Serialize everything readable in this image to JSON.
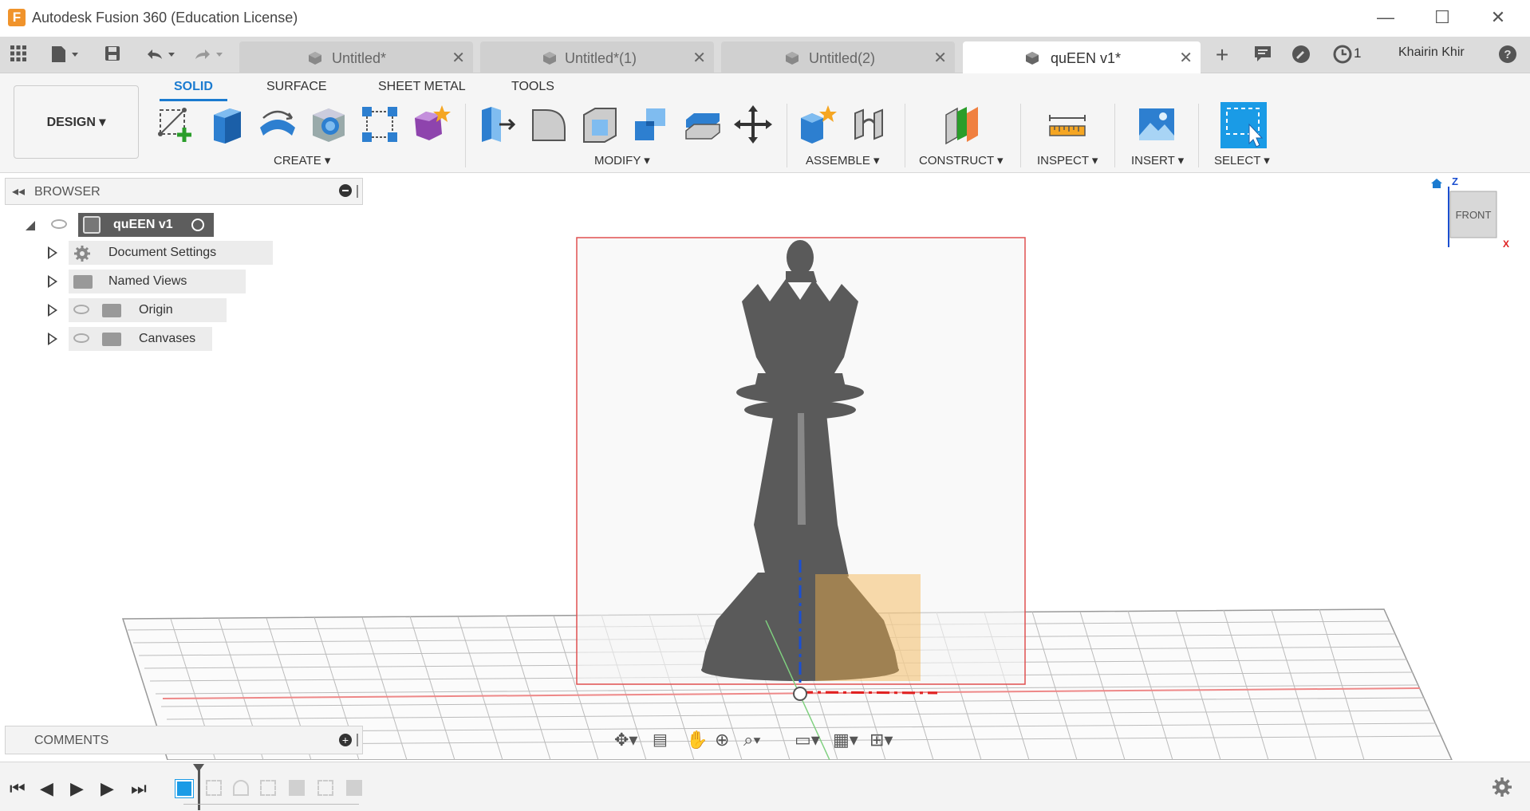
{
  "window": {
    "title": "Autodesk Fusion 360 (Education License)",
    "logo_letter": "F"
  },
  "tabs": [
    {
      "label": "Untitled*"
    },
    {
      "label": "Untitled*(1)"
    },
    {
      "label": "Untitled(2)"
    },
    {
      "label": "quEEN v1*"
    }
  ],
  "header_right": {
    "jobs_count": "1",
    "user": "Khairin Khir"
  },
  "workspace": {
    "label": "DESIGN ▾"
  },
  "ribbon_tabs": [
    "SOLID",
    "SURFACE",
    "SHEET METAL",
    "TOOLS"
  ],
  "groups": {
    "create": "CREATE ▾",
    "modify": "MODIFY ▾",
    "assemble": "ASSEMBLE ▾",
    "construct": "CONSTRUCT ▾",
    "inspect": "INSPECT ▾",
    "insert": "INSERT ▾",
    "select": "SELECT ▾"
  },
  "browser": {
    "header": "BROWSER",
    "root": "quEEN v1",
    "items": [
      "Document Settings",
      "Named Views",
      "Origin",
      "Canvases"
    ]
  },
  "comments": {
    "header": "COMMENTS"
  },
  "viewcube": {
    "face": "FRONT",
    "axis_z": "Z",
    "axis_x": "X"
  },
  "colors": {
    "accent": "#1b7bd0",
    "sketch_red": "#e05050",
    "select_blue": "#1a9be6",
    "canvas_box": "#f4b24a"
  }
}
